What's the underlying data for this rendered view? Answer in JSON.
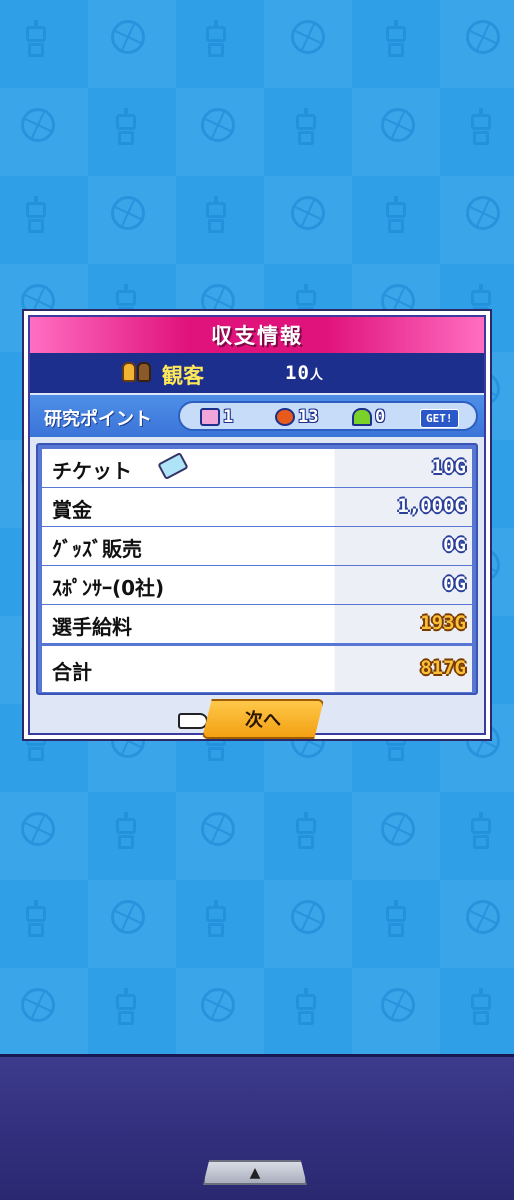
{
  "dialog": {
    "title": "収支情報",
    "audience_label": "観客",
    "audience_count": "10",
    "audience_unit": "人",
    "research_label": "研究ポイント",
    "research_points": [
      {
        "icon": "heart-icon",
        "value": "1"
      },
      {
        "icon": "basketball-icon",
        "value": "13"
      },
      {
        "icon": "helmet-icon",
        "value": "0"
      }
    ],
    "get_label": "GET!",
    "rows": [
      {
        "label": "チケット",
        "value": "10G"
      },
      {
        "label": "賞金",
        "value": "1,000G"
      },
      {
        "label": "ｸﾞｯｽﾞ販売",
        "value": "0G"
      },
      {
        "label": "ｽﾎﾟﾝｻｰ(0社)",
        "value": "0G"
      },
      {
        "label": "選手給料",
        "value": "193G"
      }
    ],
    "total_label": "合計",
    "total_value": "817G",
    "next_button": "次へ"
  },
  "colors": {
    "title_bar": "#e0127b",
    "audience_bar": "#1d2f8c",
    "next_button": "#f3a012",
    "background": "#2f9fe8"
  },
  "bottom": {
    "handle_symbol": "▲"
  }
}
